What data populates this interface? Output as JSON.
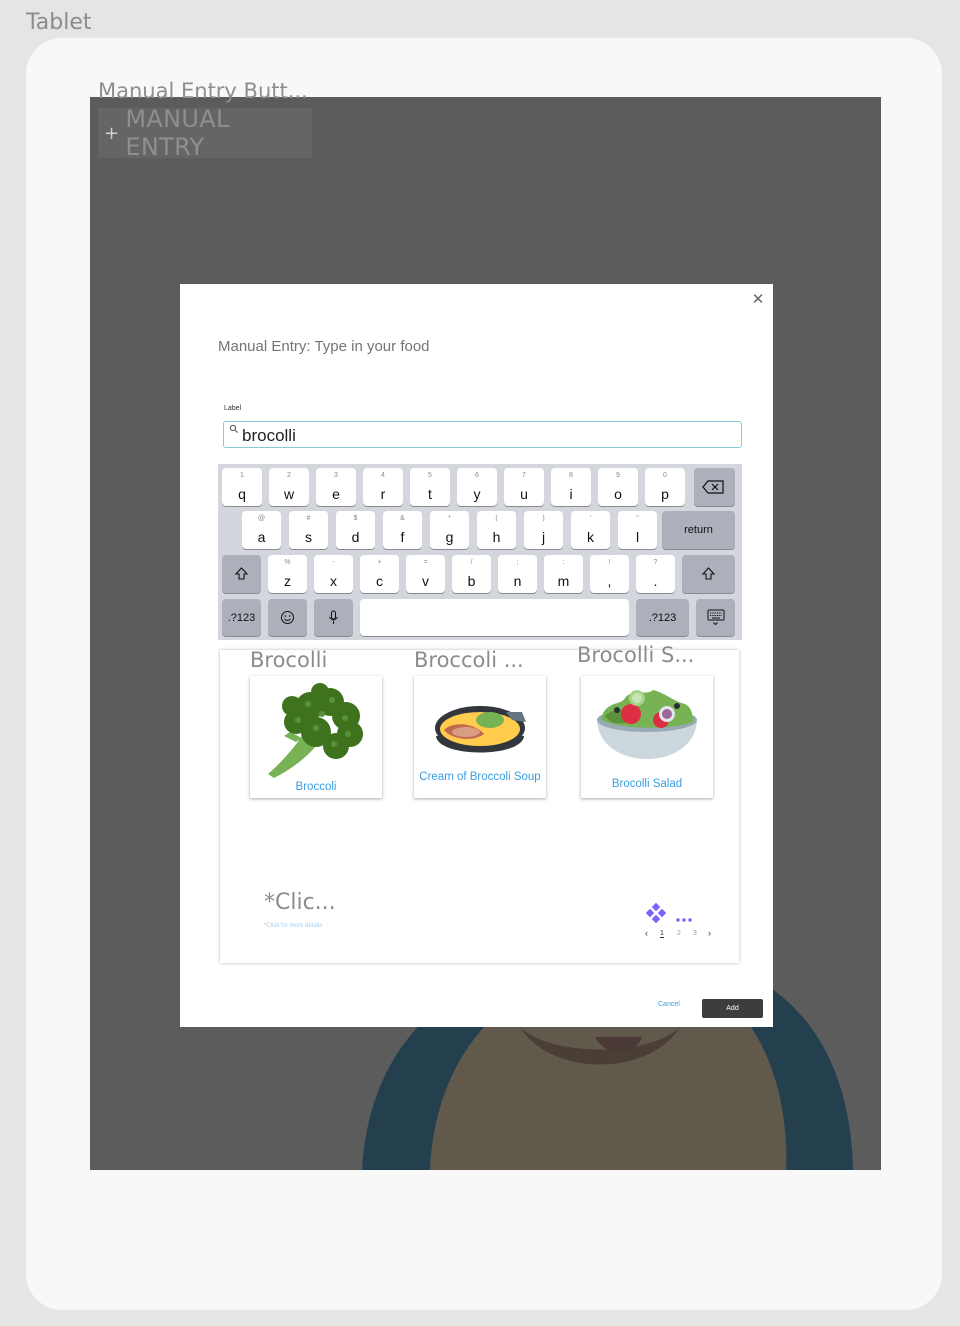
{
  "frame": {
    "title": "Tablet"
  },
  "manual_entry_button": {
    "caption": "Manual Entry Butt...",
    "plus": "+",
    "label": "MANUAL ENTRY"
  },
  "dialog": {
    "close": "✕",
    "title": "Manual Entry: Type in your food",
    "field_label": "Label",
    "search_value": "brocolli",
    "cancel": "Cancel",
    "add": "Add"
  },
  "keyboard": {
    "row1": [
      {
        "sub": "1",
        "main": "q"
      },
      {
        "sub": "2",
        "main": "w"
      },
      {
        "sub": "3",
        "main": "e"
      },
      {
        "sub": "4",
        "main": "r"
      },
      {
        "sub": "5",
        "main": "t"
      },
      {
        "sub": "6",
        "main": "y"
      },
      {
        "sub": "7",
        "main": "u"
      },
      {
        "sub": "8",
        "main": "i"
      },
      {
        "sub": "9",
        "main": "o"
      },
      {
        "sub": "0",
        "main": "p"
      }
    ],
    "row2": [
      {
        "sub": "@",
        "main": "a"
      },
      {
        "sub": "#",
        "main": "s"
      },
      {
        "sub": "$",
        "main": "d"
      },
      {
        "sub": "&",
        "main": "f"
      },
      {
        "sub": "*",
        "main": "g"
      },
      {
        "sub": "(",
        "main": "h"
      },
      {
        "sub": ")",
        "main": "j"
      },
      {
        "sub": "'",
        "main": "k"
      },
      {
        "sub": "\"",
        "main": "l"
      }
    ],
    "row3": [
      {
        "sub": "%",
        "main": "z"
      },
      {
        "sub": "-",
        "main": "x"
      },
      {
        "sub": "+",
        "main": "c"
      },
      {
        "sub": "=",
        "main": "v"
      },
      {
        "sub": "/",
        "main": "b"
      },
      {
        "sub": ";",
        "main": "n"
      },
      {
        "sub": ":",
        "main": "m"
      },
      {
        "sub": "!",
        "main": ","
      },
      {
        "sub": "?",
        "main": "."
      }
    ],
    "return_label": "return",
    "numbers_left": ".?123",
    "numbers_right": ".?123",
    "icons": {
      "backspace": "backspace-icon",
      "shift": "shift-icon",
      "emoji": "emoji-icon",
      "mic": "microphone-icon",
      "hide": "keyboard-hide-icon"
    }
  },
  "results": {
    "headings": [
      "Brocolli",
      "Broccoli ...",
      "Brocolli S..."
    ],
    "cards": [
      {
        "label": "Broccoli",
        "icon": "broccoli-icon"
      },
      {
        "label": "Cream of Broccoli Soup",
        "icon": "soup-bowl-icon"
      },
      {
        "label": "Brocolli Salad",
        "icon": "salad-bowl-icon"
      }
    ],
    "click_heading": "*Clic...",
    "click_sub": "*Click for more details",
    "pager": {
      "prev": "‹",
      "pages": [
        "1",
        "2",
        "3"
      ],
      "next": "›",
      "current": 1
    }
  },
  "colors": {
    "accent": "#3b9fe0",
    "overlay": "#5c5c5c",
    "add_button": "#3d3d3d",
    "component_icon": "#7b61ff"
  }
}
